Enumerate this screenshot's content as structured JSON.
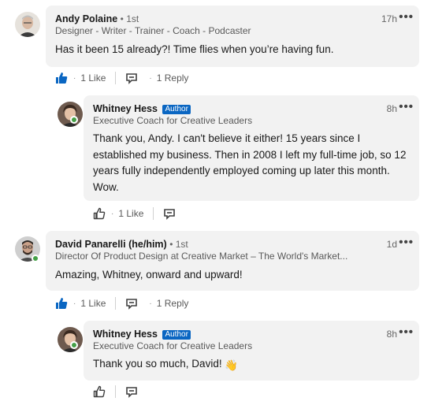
{
  "comments": [
    {
      "name": "Andy Polaine",
      "degree": "• 1st",
      "headline": "Designer - Writer - Trainer - Coach - Podcaster",
      "time": "17h",
      "text": "Has it been 15 already?! Time flies when you’re having fun.",
      "likes": "1 Like",
      "replies": "1 Reply",
      "reply": {
        "name": "Whitney Hess",
        "badge": "Author",
        "headline": "Executive Coach for Creative Leaders",
        "time": "8h",
        "text": "Thank you, Andy. I can't believe it either! 15 years since I established my business. Then in 2008 I left my full-time job, so 12 years fully independently employed coming up later this month. Wow.",
        "likes": "1 Like"
      }
    },
    {
      "name": "David Panarelli (he/him)",
      "degree": "• 1st",
      "headline": "Director Of Product Design at Creative Market – The World's Market...",
      "time": "1d",
      "text": "Amazing, Whitney, onward and upward!",
      "likes": "1 Like",
      "replies": "1 Reply",
      "reply": {
        "name": "Whitney Hess",
        "badge": "Author",
        "headline": "Executive Coach for Creative Leaders",
        "time": "8h",
        "text": "Thank you so much, David!",
        "emoji": "👋"
      }
    }
  ],
  "icons": {
    "more": "•••",
    "like_active_color": "#0a66c2",
    "presence_color": "#44a046",
    "author_badge_color": "#0a66c2"
  }
}
